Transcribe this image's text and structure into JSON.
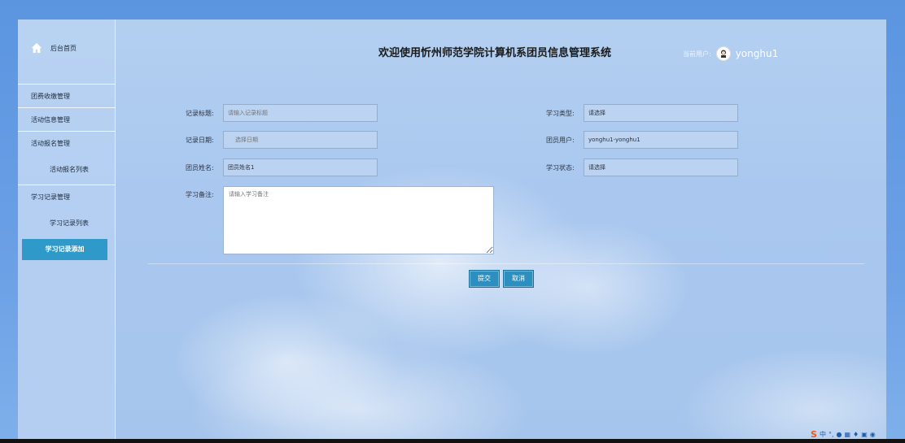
{
  "header": {
    "title": "欢迎使用忻州师范学院计算机系团员信息管理系统",
    "user_label": "当前用户:",
    "username": "yonghu1"
  },
  "sidebar": {
    "home": "后台首页",
    "groups": [
      {
        "label": "团费收缴管理"
      },
      {
        "label": "活动信息管理"
      },
      {
        "label": "活动报名管理"
      },
      {
        "label": "学习记录管理"
      }
    ],
    "subs": [
      {
        "label": "活动报名列表"
      },
      {
        "label": "学习记录列表"
      }
    ],
    "active": "学习记录添加"
  },
  "form": {
    "record_title": {
      "label": "记录标题:",
      "placeholder": "请输入记录标题"
    },
    "record_date": {
      "label": "记录日期:",
      "placeholder": "选择日期"
    },
    "member_name": {
      "label": "团员姓名:",
      "value": "团员姓名1"
    },
    "study_note": {
      "label": "学习备注:",
      "placeholder": "请输入学习备注"
    },
    "study_type": {
      "label": "学习类型:",
      "value": "请选择"
    },
    "member_user": {
      "label": "团员用户:",
      "value": "yonghu1-yonghu1"
    },
    "study_status": {
      "label": "学习状态:",
      "value": "请选择"
    }
  },
  "buttons": {
    "submit": "提交",
    "cancel": "取消"
  },
  "colors": {
    "accent": "#2f9ac9",
    "background": "#6ba0e6"
  }
}
